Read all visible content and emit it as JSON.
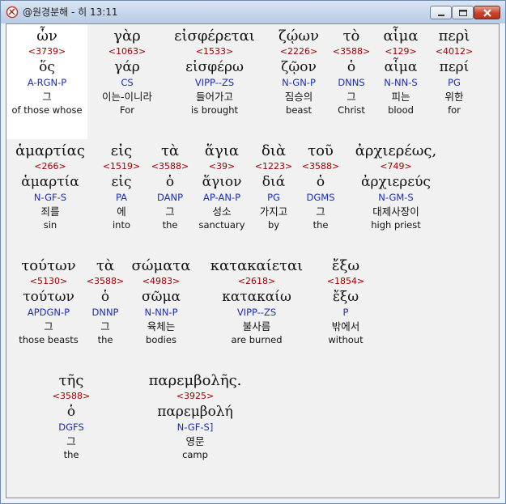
{
  "window": {
    "title": "@원경분해 - 히 13:11"
  },
  "controls": {
    "minimize": "minimize",
    "maximize": "maximize",
    "close": "close"
  },
  "words": [
    {
      "greek": "ὧν",
      "strong": "<3739>",
      "lemma": "ὅς",
      "parse": "A-RGN-P",
      "korean": "그",
      "english": "of those whose",
      "selected": true
    },
    {
      "greek": "γὰρ",
      "strong": "<1063>",
      "lemma": "γάρ",
      "parse": "CS",
      "korean": "이는-이니라",
      "english": "For"
    },
    {
      "greek": "εἰσφέρεται",
      "strong": "<1533>",
      "lemma": "εἰσφέρω",
      "parse": "VIPP--ZS",
      "korean": "들어가고",
      "english": "is brought"
    },
    {
      "greek": "ζῴων",
      "strong": "<2226>",
      "lemma": "ζῷον",
      "parse": "N-GN-P",
      "korean": "짐승의",
      "english": "beast"
    },
    {
      "greek": "τὸ",
      "strong": "<3588>",
      "lemma": "ὁ",
      "parse": "DNNS",
      "korean": "그",
      "english": "Christ"
    },
    {
      "greek": "αἷμα",
      "strong": "<129>",
      "lemma": "αἷμα",
      "parse": "N-NN-S",
      "korean": "피는",
      "english": "blood"
    },
    {
      "greek": "περὶ",
      "strong": "<4012>",
      "lemma": "περί",
      "parse": "PG",
      "korean": "위한",
      "english": "for"
    },
    {
      "greek": "ἁμαρτίας",
      "strong": "<266>",
      "lemma": "ἁμαρτία",
      "parse": "N-GF-S",
      "korean": "죄를",
      "english": "sin"
    },
    {
      "greek": "εἰς",
      "strong": "<1519>",
      "lemma": "εἰς",
      "parse": "PA",
      "korean": "에",
      "english": "into"
    },
    {
      "greek": "τὰ",
      "strong": "<3588>",
      "lemma": "ὁ",
      "parse": "DANP",
      "korean": "그",
      "english": "the"
    },
    {
      "greek": "ἅγια",
      "strong": "<39>",
      "lemma": "ἅγιον",
      "parse": "AP-AN-P",
      "korean": "성소",
      "english": "sanctuary"
    },
    {
      "greek": "διὰ",
      "strong": "<1223>",
      "lemma": "διά",
      "parse": "PG",
      "korean": "가지고",
      "english": "by"
    },
    {
      "greek": "τοῦ",
      "strong": "<3588>",
      "lemma": "ὁ",
      "parse": "DGMS",
      "korean": "그",
      "english": "the"
    },
    {
      "greek": "ἀρχιερέως,",
      "strong": "<749>",
      "lemma": "ἀρχιερεύς",
      "parse": "N-GM-S",
      "korean": "대제사장이",
      "english": "high priest"
    },
    {
      "greek": "τούτων",
      "strong": "<5130>",
      "lemma": "τούτων",
      "parse": "APDGN-P",
      "korean": "그",
      "english": "those beasts"
    },
    {
      "greek": "τὰ",
      "strong": "<3588>",
      "lemma": "ὁ",
      "parse": "DNNP",
      "korean": "그",
      "english": "the"
    },
    {
      "greek": "σώματα",
      "strong": "<4983>",
      "lemma": "σῶμα",
      "parse": "N-NN-P",
      "korean": "육체는",
      "english": "bodies"
    },
    {
      "greek": "κατακαίεται",
      "strong": "<2618>",
      "lemma": "κατακαίω",
      "parse": "VIPP--ZS",
      "korean": "불사름",
      "english": "are burned"
    },
    {
      "greek": "ἔξω",
      "strong": "<1854>",
      "lemma": "ἔξω",
      "parse": "P",
      "korean": "밖에서",
      "english": "without"
    },
    {
      "greek": "τῆς",
      "strong": "<3588>",
      "lemma": "ὁ",
      "parse": "DGFS",
      "korean": "그",
      "english": "the"
    },
    {
      "greek": "παρεμβολῆς.",
      "strong": "<3925>",
      "lemma": "παρεμβολή",
      "parse": "N-GF-S]",
      "korean": "영문",
      "english": "camp"
    }
  ]
}
